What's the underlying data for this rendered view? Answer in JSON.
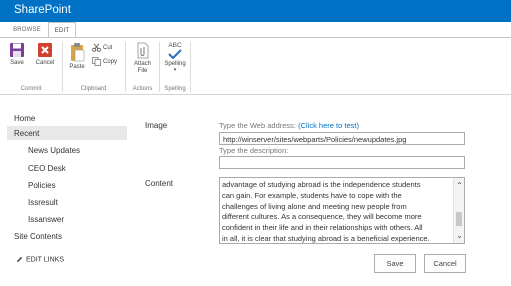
{
  "suite": {
    "title": "SharePoint"
  },
  "tabs": [
    {
      "label": "BROWSE"
    },
    {
      "label": "EDIT"
    }
  ],
  "ribbon": {
    "commit": {
      "label": "Commit",
      "save": "Save",
      "cancel": "Cancel"
    },
    "clipboard": {
      "label": "Clipboard",
      "paste": "Paste",
      "cut": "Cut",
      "copy": "Copy"
    },
    "actions": {
      "label": "Actions",
      "attach_line1": "Attach",
      "attach_line2": "File"
    },
    "spelling": {
      "label": "Spelling",
      "button": "Spelling",
      "abc": "ABC"
    }
  },
  "nav": {
    "items": [
      {
        "label": "Home"
      },
      {
        "label": "Recent"
      },
      {
        "label": "News Updates"
      },
      {
        "label": "CEO Desk"
      },
      {
        "label": "Policies"
      },
      {
        "label": "Issresult"
      },
      {
        "label": "Issanswer"
      },
      {
        "label": "Site Contents"
      }
    ],
    "edit_links": "EDIT LINKS"
  },
  "form": {
    "image_label": "Image",
    "web_address_hint": "Type the Web address:",
    "test_link": "(Click here to test)",
    "url_value": "http://winserver/sites/webparts/Policies/newupdates.jpg",
    "description_hint": "Type the description:",
    "description_value": "",
    "content_label": "Content",
    "content_text": "advantage of studying abroad is the independence students\ncan gain. For example, students have to cope with the\nchallenges of living alone and meeting new people from\ndifferent cultures.  As a consequence, they will become more\nconfident in their life and in their relationships with others.  All\nin all, it is clear that studying abroad is a beneficial experience."
  },
  "buttons": {
    "save": "Save",
    "cancel": "Cancel"
  },
  "colors": {
    "suite_bar": "#0072c6",
    "link": "#0072c6",
    "save_icon": "#7b3f98",
    "cancel_icon": "#d0422f"
  }
}
